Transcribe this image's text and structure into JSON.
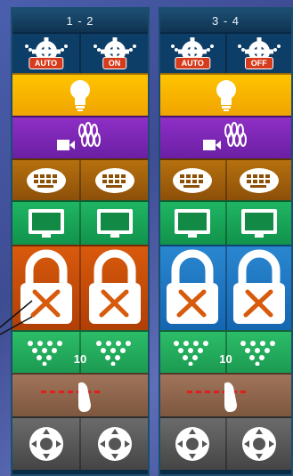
{
  "lanes": [
    {
      "id": "1-2",
      "title": "1 - 2",
      "modes": [
        "AUTO",
        "ON"
      ],
      "lock_color": "orange",
      "pins_count": "10"
    },
    {
      "id": "3-4",
      "title": "3 - 4",
      "modes": [
        "AUTO",
        "OFF"
      ],
      "lock_color": "blue",
      "pins_count": "10"
    }
  ],
  "colors": {
    "panel": "#0a2b44",
    "light": "#ffc400",
    "camera": "#8e2fc6",
    "keyboard": "#b5700e",
    "screen": "#1fb563",
    "lock_orange": "#d85a0c",
    "lock_blue": "#2a86d0",
    "pins": "#2cbd68",
    "foul": "#a0745a",
    "joystick": "#6b6b6b",
    "badge": "#d63b1c"
  },
  "icons": [
    "pinsetter-gear-icon",
    "light-bulb-icon",
    "camera-pins-icon",
    "keyboard-icon",
    "monitor-icon",
    "maintenance-lock-icon",
    "pins-rack-icon",
    "foul-line-icon",
    "joystick-icon"
  ]
}
